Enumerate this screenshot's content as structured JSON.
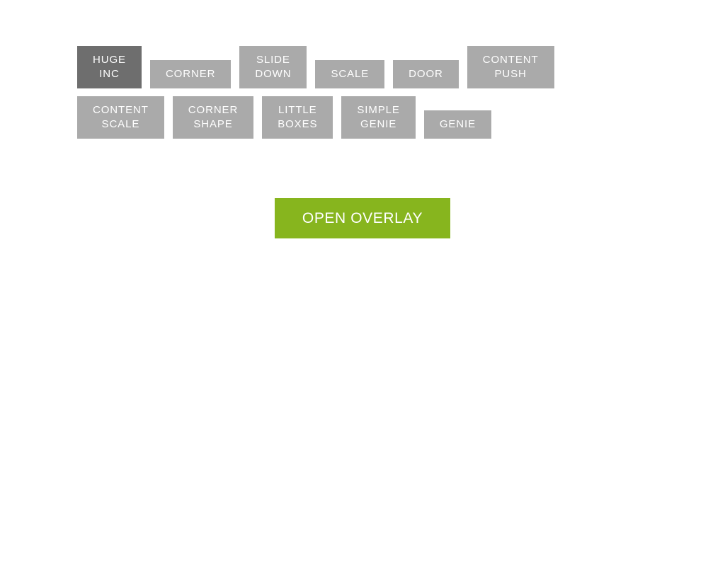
{
  "page": {
    "background_color": "#ffffff"
  },
  "theme": {
    "button_inactive_color": "#aaaaaa",
    "button_active_color": "#6e6e6e",
    "button_text_color": "#ffffff",
    "accent_color": "#87b51e"
  },
  "transition_selector": {
    "rows": [
      {
        "buttons": [
          {
            "label": "HUGE\nINC",
            "lines": 2,
            "active": true
          },
          {
            "label": "CORNER",
            "lines": 1,
            "active": false
          },
          {
            "label": "SLIDE\nDOWN",
            "lines": 2,
            "active": false
          },
          {
            "label": "SCALE",
            "lines": 1,
            "active": false
          },
          {
            "label": "DOOR",
            "lines": 1,
            "active": false
          },
          {
            "label": "CONTENT\nPUSH",
            "lines": 2,
            "active": false
          }
        ]
      },
      {
        "buttons": [
          {
            "label": "CONTENT\nSCALE",
            "lines": 2,
            "active": false
          },
          {
            "label": "CORNER\nSHAPE",
            "lines": 2,
            "active": false
          },
          {
            "label": "LITTLE\nBOXES",
            "lines": 2,
            "active": false
          },
          {
            "label": "SIMPLE\nGENIE",
            "lines": 2,
            "active": false
          },
          {
            "label": "GENIE",
            "lines": 1,
            "active": false
          }
        ]
      }
    ]
  },
  "main_action": {
    "open_overlay_label": "OPEN OVERLAY"
  }
}
